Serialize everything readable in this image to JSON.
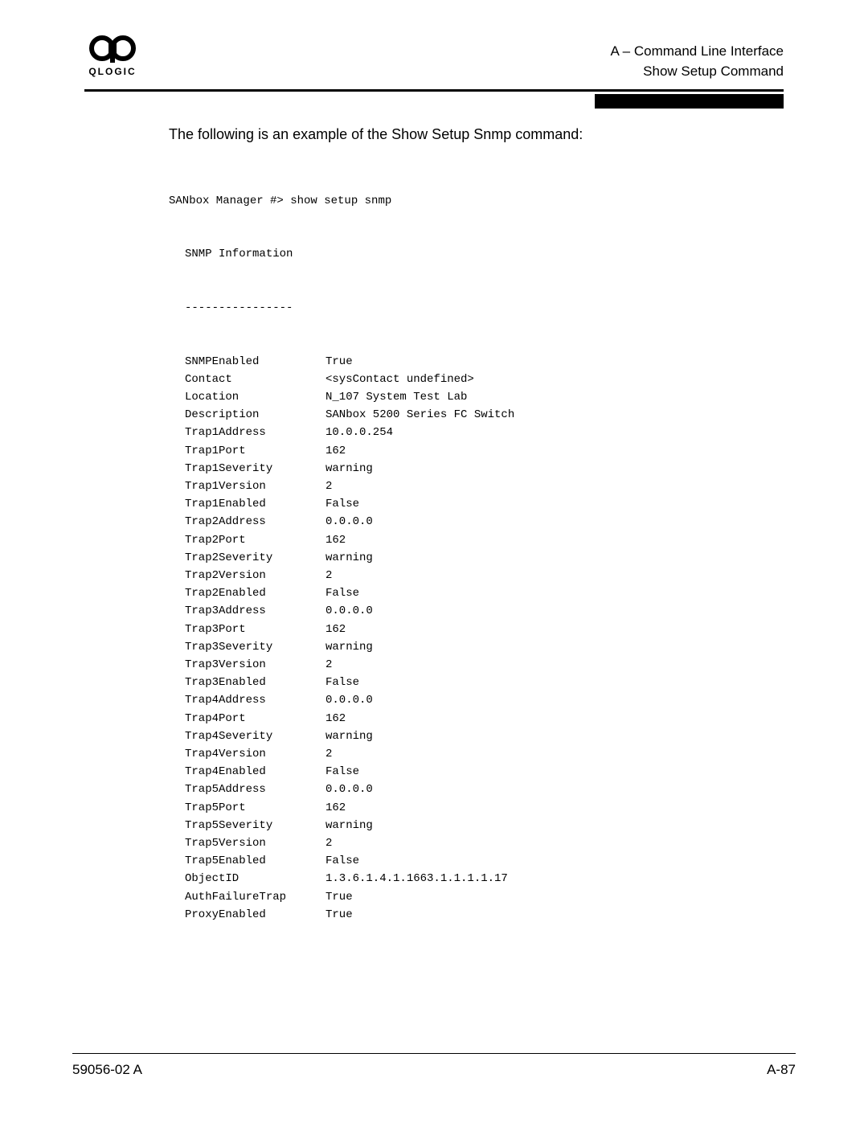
{
  "header": {
    "logo_text": "QLOGIC",
    "line1": "A – Command Line Interface",
    "line2": "Show Setup Command"
  },
  "section_intro": "The following is an example of the Show Setup Snmp command:",
  "cli_prompt": "SANbox Manager #> show setup snmp",
  "cli_subhead": "SNMP Information",
  "cli_rule": "----------------",
  "rows": [
    {
      "k": "SNMPEnabled",
      "v": "True"
    },
    {
      "k": "Contact",
      "v": "<sysContact undefined>"
    },
    {
      "k": "Location",
      "v": "N_107 System Test Lab"
    },
    {
      "k": "Description",
      "v": "SANbox 5200 Series FC Switch"
    },
    {
      "k": "Trap1Address",
      "v": "10.0.0.254"
    },
    {
      "k": "Trap1Port",
      "v": "162"
    },
    {
      "k": "Trap1Severity",
      "v": "warning"
    },
    {
      "k": "Trap1Version",
      "v": "2"
    },
    {
      "k": "Trap1Enabled",
      "v": "False"
    },
    {
      "k": "Trap2Address",
      "v": "0.0.0.0"
    },
    {
      "k": "Trap2Port",
      "v": "162"
    },
    {
      "k": "Trap2Severity",
      "v": "warning"
    },
    {
      "k": "Trap2Version",
      "v": "2"
    },
    {
      "k": "Trap2Enabled",
      "v": "False"
    },
    {
      "k": "Trap3Address",
      "v": "0.0.0.0"
    },
    {
      "k": "Trap3Port",
      "v": "162"
    },
    {
      "k": "Trap3Severity",
      "v": "warning"
    },
    {
      "k": "Trap3Version",
      "v": "2"
    },
    {
      "k": "Trap3Enabled",
      "v": "False"
    },
    {
      "k": "Trap4Address",
      "v": "0.0.0.0"
    },
    {
      "k": "Trap4Port",
      "v": "162"
    },
    {
      "k": "Trap4Severity",
      "v": "warning"
    },
    {
      "k": "Trap4Version",
      "v": "2"
    },
    {
      "k": "Trap4Enabled",
      "v": "False"
    },
    {
      "k": "Trap5Address",
      "v": "0.0.0.0"
    },
    {
      "k": "Trap5Port",
      "v": "162"
    },
    {
      "k": "Trap5Severity",
      "v": "warning"
    },
    {
      "k": "Trap5Version",
      "v": "2"
    },
    {
      "k": "Trap5Enabled",
      "v": "False"
    },
    {
      "k": "ObjectID",
      "v": "1.3.6.1.4.1.1663.1.1.1.1.17"
    },
    {
      "k": "AuthFailureTrap",
      "v": "True"
    },
    {
      "k": "ProxyEnabled",
      "v": "True"
    }
  ],
  "footer": {
    "left": "59056-02 A",
    "right": "A-87"
  }
}
